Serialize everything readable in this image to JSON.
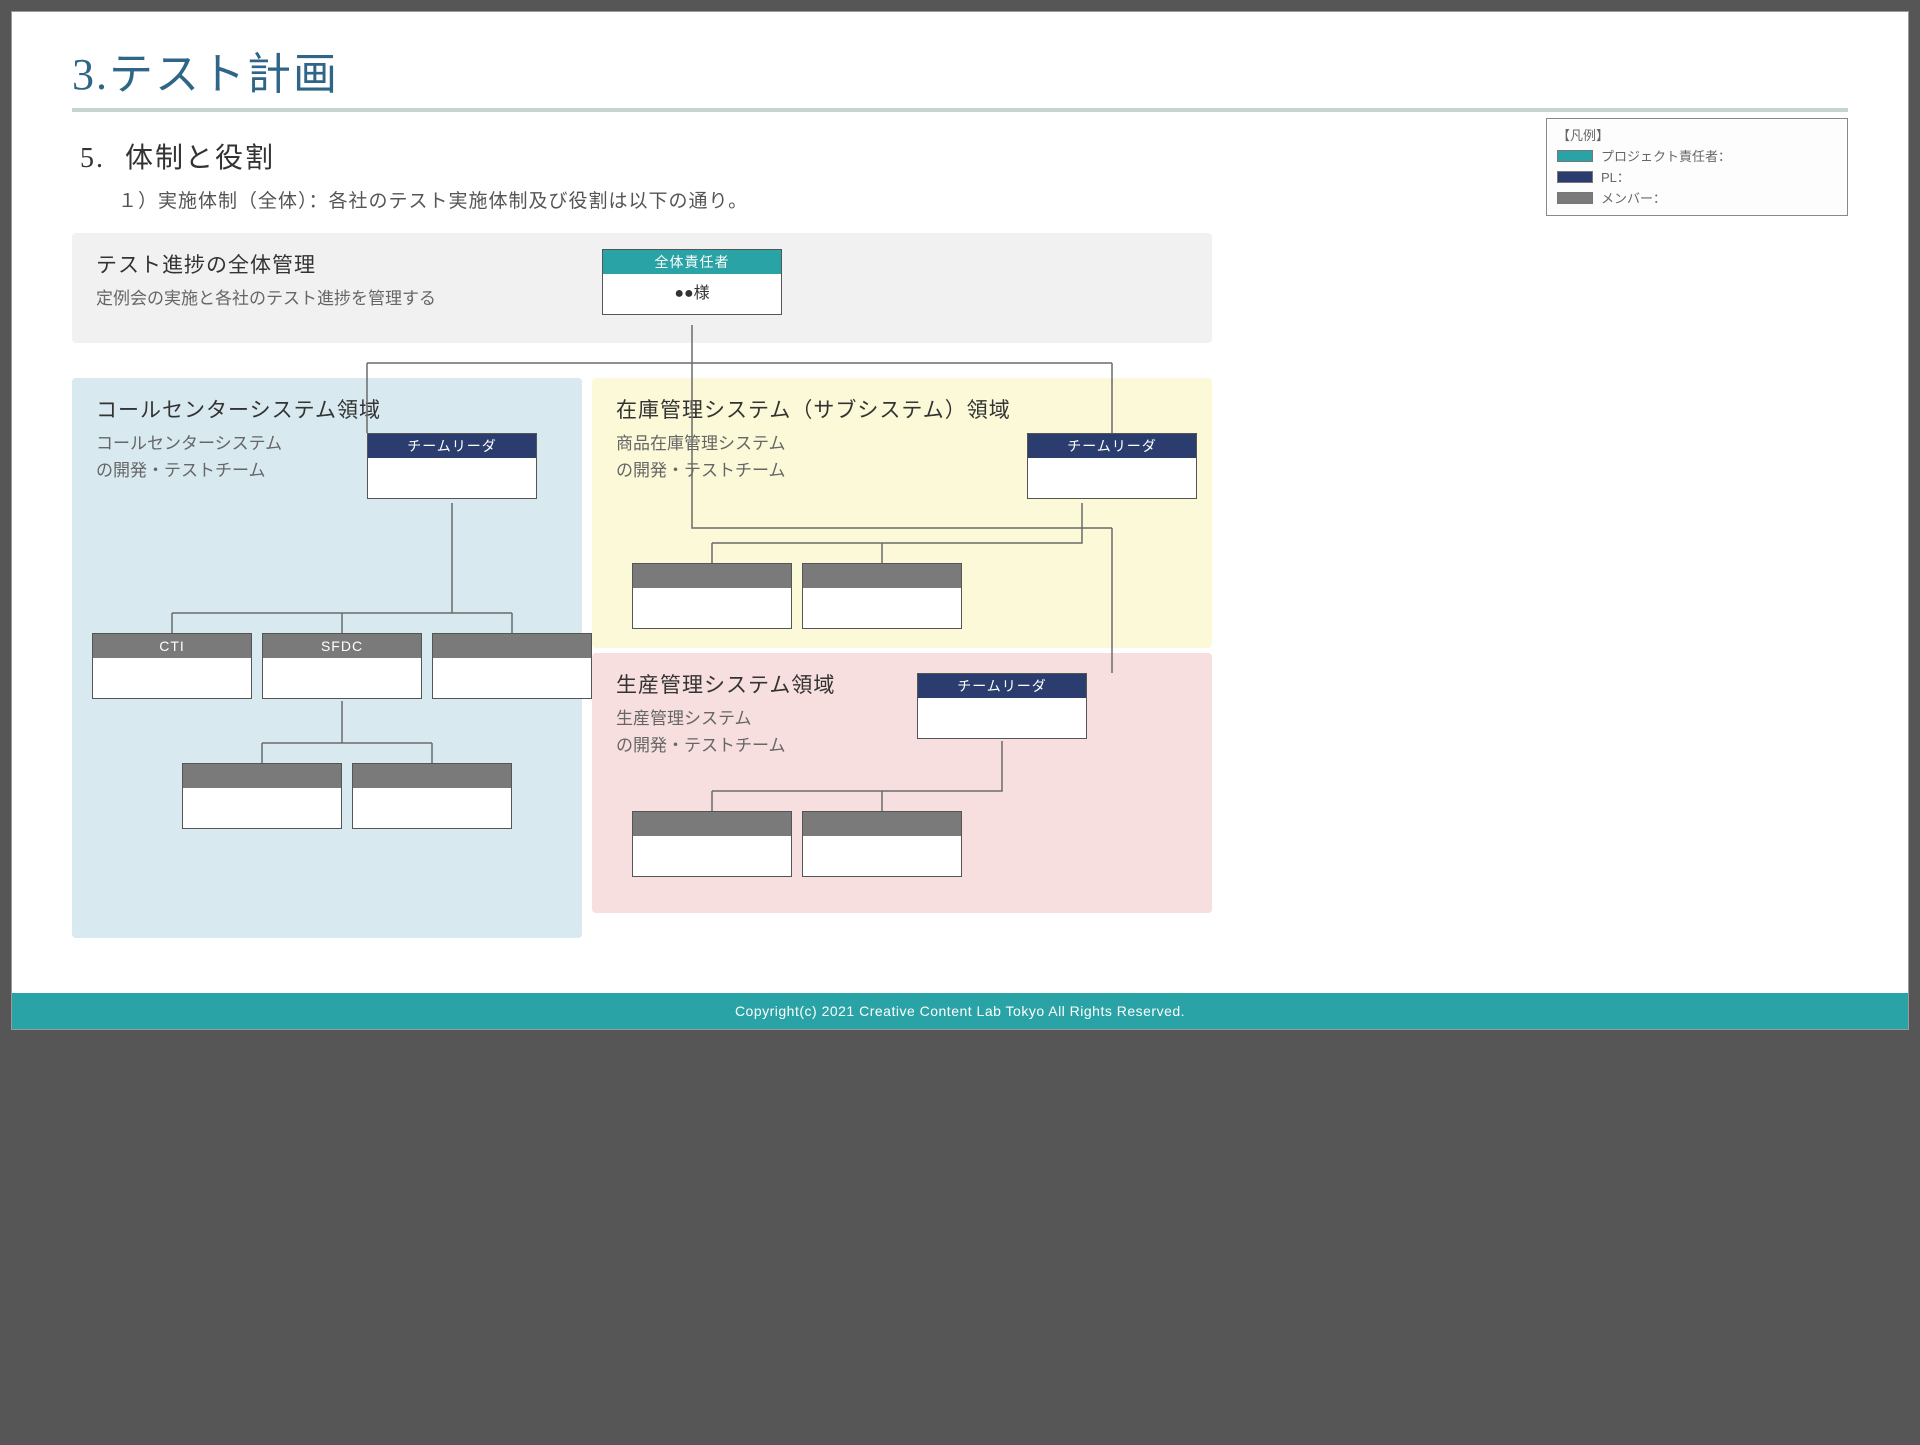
{
  "page": {
    "main_title": "3.テスト計画",
    "section_num": "5.",
    "section_title": "体制と役割",
    "section_desc": "１）実施体制（全体）：各社のテスト実施体制及び役割は以下の通り。"
  },
  "legend": {
    "title": "【凡例】",
    "items": [
      {
        "color": "teal",
        "label": "プロジェクト責任者："
      },
      {
        "color": "navy",
        "label": "PL："
      },
      {
        "color": "grey",
        "label": "メンバー："
      }
    ]
  },
  "overall": {
    "title": "テスト進捗の全体管理",
    "desc": "定例会の実施と各社のテスト進捗を管理する",
    "role": "全体責任者",
    "name": "●●様"
  },
  "areas": {
    "callcenter": {
      "title": "コールセンターシステム領域",
      "desc1": "コールセンターシステム",
      "desc2": "の開発・テストチーム",
      "lead": "チームリーダ",
      "children": [
        {
          "label": "CTI"
        },
        {
          "label": "SFDC"
        },
        {
          "label": ""
        }
      ],
      "sfdc_children": [
        {
          "label": ""
        },
        {
          "label": ""
        }
      ]
    },
    "inventory": {
      "title": "在庫管理システム（サブシステム）領域",
      "desc1": "商品在庫管理システム",
      "desc2": "の開発・テストチーム",
      "lead": "チームリーダ",
      "children": [
        {
          "label": ""
        },
        {
          "label": ""
        }
      ]
    },
    "production": {
      "title": "生産管理システム領域",
      "desc1": "生産管理システム",
      "desc2": "の開発・テストチーム",
      "lead": "チームリーダ",
      "children": [
        {
          "label": ""
        },
        {
          "label": ""
        }
      ]
    }
  },
  "footer": "Copyright(c) 2021 Creative Content Lab Tokyo All Rights Reserved."
}
